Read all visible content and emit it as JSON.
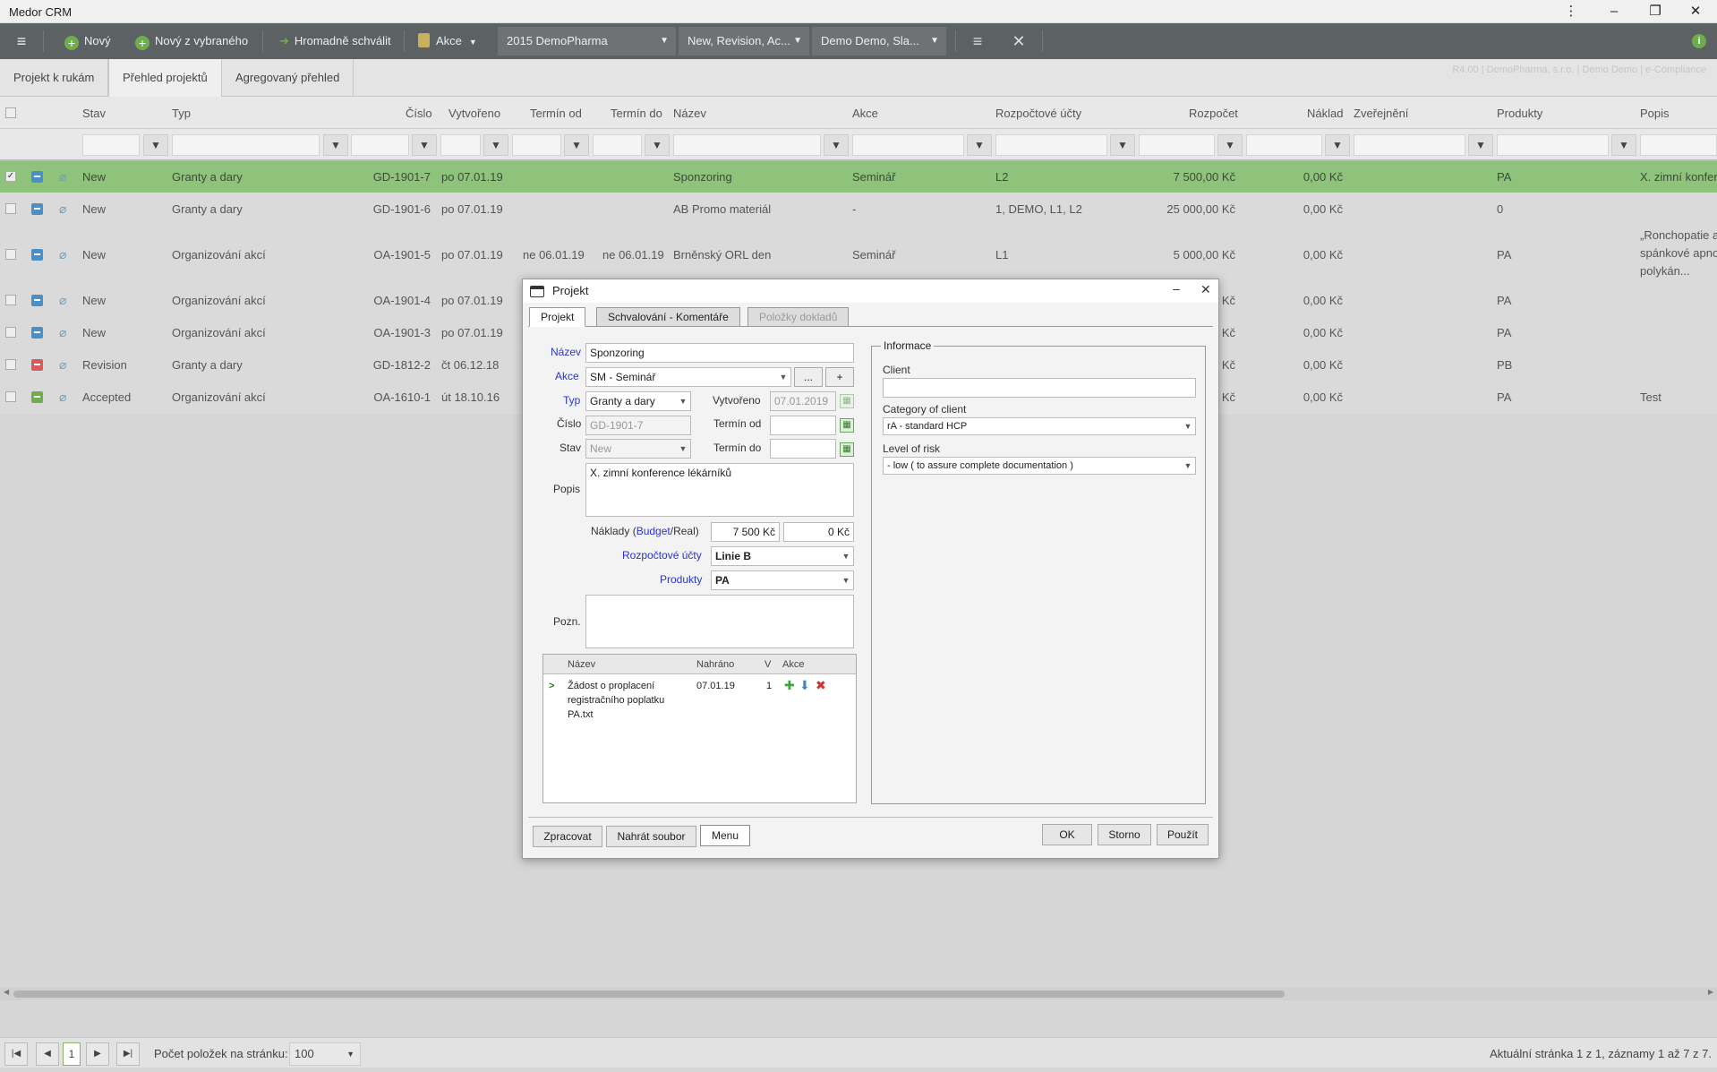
{
  "app": {
    "title": "Medor CRM",
    "window_controls": [
      "⋮",
      "–",
      "❐",
      "✕"
    ]
  },
  "toolbar": {
    "new_label": "Nový",
    "new_from_selected_label": "Nový z vybraného",
    "bulk_approve_label": "Hromadně schválit",
    "actions_label": "Akce",
    "filter_year": "2015 DemoPharma",
    "filter_status": "New, Revision, Ac...",
    "filter_user": "Demo Demo, Sla..."
  },
  "tabs": [
    "Projekt k rukám",
    "Přehled projektů",
    "Agregovaný přehled"
  ],
  "version_info": "R4.00 | DemoPharma, s.r.o. | Demo Demo | e-Compliance",
  "grid": {
    "columns": [
      "Stav",
      "Typ",
      "Číslo",
      "Vytvořeno",
      "Termín od",
      "Termín do",
      "Název",
      "Akce",
      "Rozpočtové účty",
      "Rozpočet",
      "Náklad",
      "Zveřejnění",
      "Produkty",
      "Popis"
    ],
    "rows": [
      {
        "stav": "New",
        "typ": "Granty a dary",
        "cislo": "GD-1901-7",
        "vytvoreno": "po 07.01.19",
        "od": "",
        "do": "",
        "nazev": "Sponzoring",
        "akce": "Seminář",
        "ucty": "L2",
        "rozpocet": "7 500,00 Kč",
        "naklad": "0,00 Kč",
        "produkty": "PA",
        "popis": "X. zimní konfere",
        "status_color": "#4a90c8"
      },
      {
        "stav": "New",
        "typ": "Granty a dary",
        "cislo": "GD-1901-6",
        "vytvoreno": "po 07.01.19",
        "od": "",
        "do": "",
        "nazev": "AB Promo materiál",
        "akce": "-",
        "ucty": "1, DEMO, L1, L2",
        "rozpocet": "25 000,00 Kč",
        "naklad": "0,00 Kč",
        "produkty": "0",
        "popis": "",
        "status_color": "#4a90c8"
      },
      {
        "stav": "New",
        "typ": "Organizování akcí",
        "cislo": "OA-1901-5",
        "vytvoreno": "po 07.01.19",
        "od": "ne 06.01.19",
        "do": "ne 06.01.19",
        "nazev": "Brněnský ORL den",
        "akce": "Seminář",
        "ucty": "L1",
        "rozpocet": "5 000,00 Kč",
        "naklad": "0,00 Kč",
        "produkty": "PA",
        "popis": "„Ronchopatie a",
        "popis2": "spánkové apno",
        "popis3": "polykán...",
        "status_color": "#4a90c8"
      },
      {
        "stav": "New",
        "typ": "Organizování akcí",
        "cislo": "OA-1901-4",
        "vytvoreno": "po 07.01.19",
        "od": "",
        "do": "",
        "nazev": "",
        "akce": "",
        "ucty": "",
        "rozpocet": "Kč",
        "naklad": "0,00 Kč",
        "produkty": "PA",
        "popis": "",
        "status_color": "#4a90c8"
      },
      {
        "stav": "New",
        "typ": "Organizování akcí",
        "cislo": "OA-1901-3",
        "vytvoreno": "po 07.01.19",
        "od": "",
        "do": "",
        "nazev": "",
        "akce": "",
        "ucty": "",
        "rozpocet": "Kč",
        "naklad": "0,00 Kč",
        "produkty": "PA",
        "popis": "",
        "status_color": "#4a90c8"
      },
      {
        "stav": "Revision",
        "typ": "Granty a dary",
        "cislo": "GD-1812-2",
        "vytvoreno": "čt 06.12.18",
        "od": "",
        "do": "",
        "nazev": "",
        "akce": "",
        "ucty": "",
        "rozpocet": "Kč",
        "naklad": "0,00 Kč",
        "produkty": "PB",
        "popis": "",
        "status_color": "#d85a5a"
      },
      {
        "stav": "Accepted",
        "typ": "Organizování akcí",
        "cislo": "OA-1610-1",
        "vytvoreno": "út 18.10.16",
        "od": "",
        "do": "",
        "nazev": "",
        "akce": "",
        "ucty": "",
        "rozpocet": "Kč",
        "naklad": "0,00 Kč",
        "produkty": "PA",
        "popis": "Test",
        "status_color": "#6dae4c"
      }
    ]
  },
  "pager": {
    "page": "1",
    "per_page_label": "Počet položek na stránku:",
    "per_page": "100",
    "status": "Aktuální stránka 1 z 1, záznamy 1 až 7 z 7."
  },
  "dialog": {
    "title": "Projekt",
    "tabs": [
      "Projekt",
      "Schvalování - Komentáře",
      "Položky dokladů"
    ],
    "labels": {
      "nazev": "Název",
      "akce": "Akce",
      "typ": "Typ",
      "cislo": "Číslo",
      "stav": "Stav",
      "vytvoreno": "Vytvořeno",
      "termin_od": "Termín od",
      "termin_do": "Termín do",
      "popis": "Popis",
      "naklady_a": "Náklady (",
      "budget": "Budget",
      "slash": "/Real)",
      "ucty": "Rozpočtové účty",
      "produkty": "Produkty",
      "pozn": "Pozn."
    },
    "values": {
      "nazev": "Sponzoring",
      "akce": "SM - Seminář",
      "typ": "Granty a dary",
      "cislo": "GD-1901-7",
      "stav": "New",
      "vytvoreno": "07.01.2019",
      "termin_od": "",
      "termin_do": "",
      "popis": "X. zimní konference lékárníků",
      "budget": "7 500 Kč",
      "real": "0 Kč",
      "ucty": "Linie B",
      "produkty": "PA",
      "pozn": ""
    },
    "small_buttons": [
      "...",
      "+"
    ],
    "files": {
      "headers": [
        "Název",
        "Nahráno",
        "V",
        "Akce"
      ],
      "rows": [
        {
          "name1": "Žádost o proplacení",
          "name2": "registračního poplatku",
          "name3": "PA.txt",
          "date": "07.01.19",
          "v": "1"
        }
      ]
    },
    "info": {
      "legend": "Informace",
      "client_label": "Client",
      "client_value": "",
      "category_label": "Category of client",
      "category_value": "rA - standard HCP",
      "risk_label": "Level of risk",
      "risk_value": "- low ( to assure complete documentation )"
    },
    "footer": {
      "process": "Zpracovat",
      "upload": "Nahrát soubor",
      "menu": "Menu",
      "ok": "OK",
      "cancel": "Storno",
      "apply": "Použít"
    }
  }
}
